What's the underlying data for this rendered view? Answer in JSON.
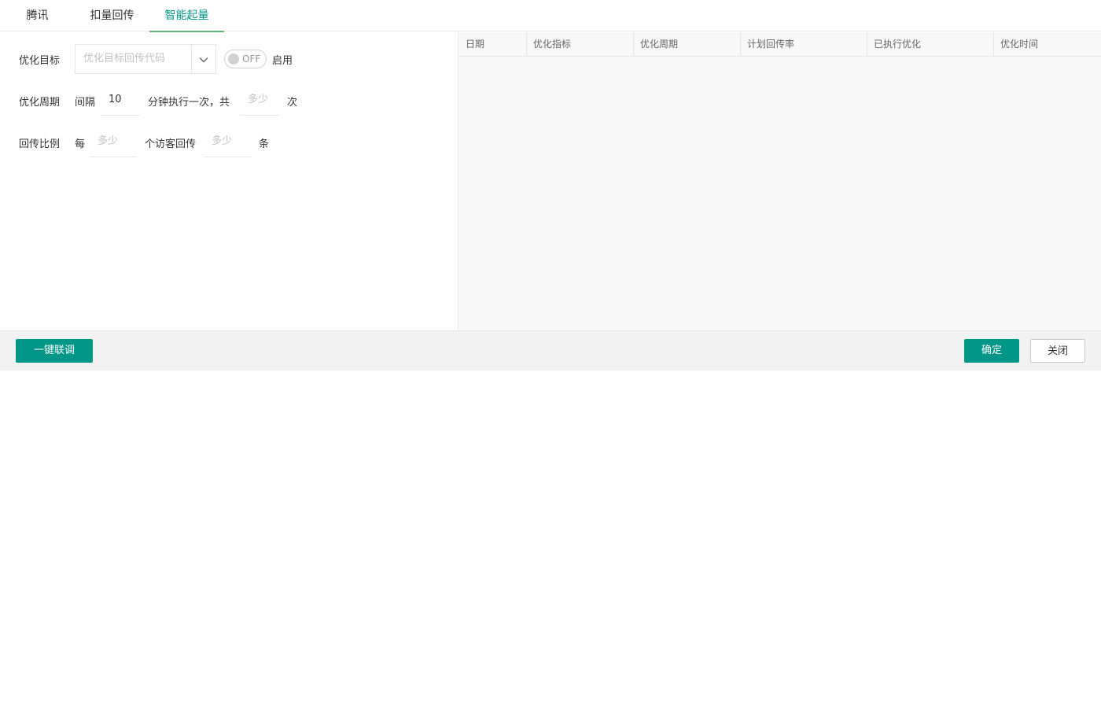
{
  "tabs": [
    {
      "label": "腾讯"
    },
    {
      "label": "扣量回传"
    },
    {
      "label": "智能起量"
    }
  ],
  "form": {
    "target_label": "优化目标",
    "target_placeholder": "优化目标回传代码",
    "switch_text": "OFF",
    "enable_label": "启用",
    "cycle_label": "优化周期",
    "interval_text": "间隔",
    "interval_value": "10",
    "minutes_text": "分钟执行一次，共",
    "times_placeholder": "多少",
    "times_unit": "次",
    "ratio_label": "回传比例",
    "every_text": "每",
    "per_placeholder": "多少",
    "visitors_text": "个访客回传",
    "count_placeholder": "多少",
    "count_unit": "条"
  },
  "table": {
    "columns": [
      "日期",
      "优化指标",
      "优化周期",
      "计划回传率",
      "已执行优化",
      "优化时间"
    ]
  },
  "footer": {
    "debug_button": "一键联调",
    "confirm_button": "确定",
    "close_button": "关闭"
  },
  "colors": {
    "accent": "#009688",
    "tab_underline": "#5fb878"
  }
}
